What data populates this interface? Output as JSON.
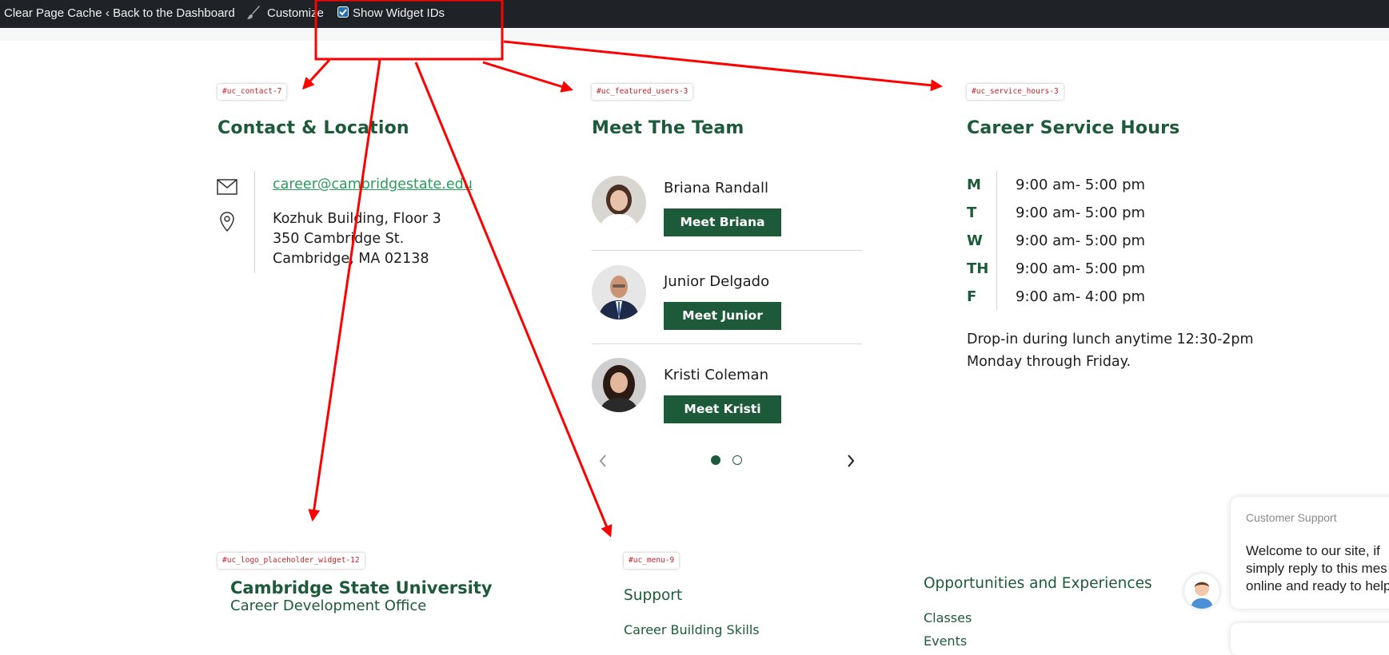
{
  "adminbar": {
    "clear_cache": "Clear Page Cache",
    "back": "‹ Back to the Dashboard",
    "customize": "Customize",
    "show_ids": "Show Widget IDs",
    "show_ids_checked": true
  },
  "widgets": {
    "contact_id": "#uc_contact-7",
    "team_id": "#uc_featured_users-3",
    "hours_id": "#uc_service_hours-3",
    "logo_id": "#uc_logo_placeholder_widget-12",
    "menu_id": "#uc_menu-9"
  },
  "contact": {
    "title": "Contact & Location",
    "email": "career@cambridgestate.edu",
    "address": [
      "Kozhuk Building, Floor 3",
      "350 Cambridge St.",
      "Cambridge, MA 02138"
    ],
    "icons": [
      "mail-icon",
      "location-pin-icon"
    ]
  },
  "team": {
    "title": "Meet The Team",
    "members": [
      {
        "name": "Briana Randall",
        "button": "Meet Briana"
      },
      {
        "name": "Junior Delgado",
        "button": "Meet Junior"
      },
      {
        "name": "Kristi Coleman",
        "button": "Meet Kristi"
      }
    ],
    "pagination": {
      "pages": 2,
      "current": 1
    }
  },
  "hours": {
    "title": "Career Service Hours",
    "rows": [
      {
        "day": "M",
        "time": "9:00 am- 5:00 pm"
      },
      {
        "day": "T",
        "time": "9:00 am- 5:00 pm"
      },
      {
        "day": "W",
        "time": "9:00 am- 5:00 pm"
      },
      {
        "day": "TH",
        "time": "9:00 am- 5:00 pm"
      },
      {
        "day": "F",
        "time": "9:00 am- 4:00 pm"
      }
    ],
    "note": [
      "Drop-in during lunch anytime 12:30-2pm",
      "Monday through Friday."
    ]
  },
  "footer": {
    "university": "Cambridge State University",
    "office": "Career Development Office",
    "support_heading": "Support",
    "support_links": [
      "Career Building Skills"
    ],
    "opportunities_heading": "Opportunities and Experiences",
    "opportunities_links": [
      "Classes",
      "Events"
    ]
  },
  "chat": {
    "title": "Customer Support",
    "lines": [
      "Welcome to our site, if",
      "simply reply to this mes",
      "online and ready to help"
    ]
  },
  "colors": {
    "brand_green": "#1d5a3a",
    "link_green": "#2c9a5c",
    "admin_bg": "#1f2327",
    "annotation_red": "#ff0000"
  }
}
